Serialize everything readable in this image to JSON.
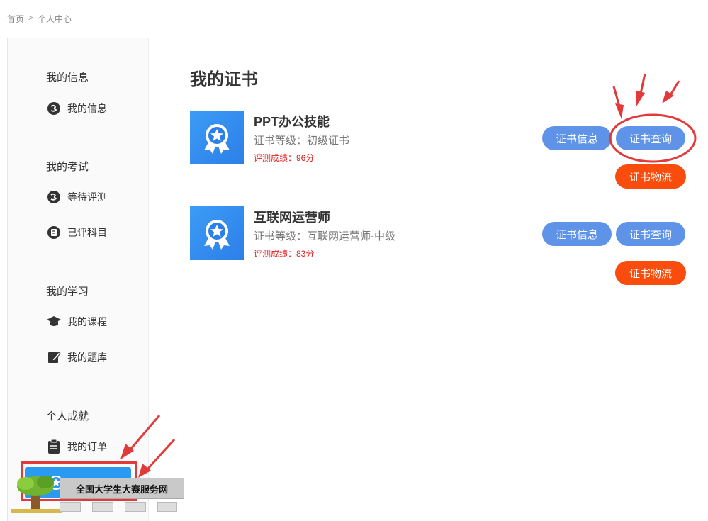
{
  "breadcrumb": {
    "home": "首页",
    "separator": ">",
    "current": "个人中心"
  },
  "sidebar": {
    "sections": [
      {
        "title": "我的信息",
        "items": [
          {
            "label": "我的信息",
            "icon": "info-icon"
          }
        ]
      },
      {
        "title": "我的考试",
        "items": [
          {
            "label": "等待评测",
            "icon": "pending-icon"
          },
          {
            "label": "已评科目",
            "icon": "done-icon"
          }
        ]
      },
      {
        "title": "我的学习",
        "items": [
          {
            "label": "我的课程",
            "icon": "graduation-cap-icon"
          },
          {
            "label": "我的题库",
            "icon": "edit-icon"
          }
        ]
      },
      {
        "title": "个人成就",
        "items": [
          {
            "label": "我的订单",
            "icon": "clipboard-icon"
          }
        ]
      }
    ]
  },
  "page": {
    "title": "我的证书"
  },
  "certificates": [
    {
      "name": "PPT办公技能",
      "level": "证书等级：初级证书",
      "score": "评测成绩：96分"
    },
    {
      "name": "互联网运营师",
      "level": "证书等级：互联网运营师-中级",
      "score": "评测成绩：83分"
    }
  ],
  "buttons": {
    "info": "证书信息",
    "query": "证书查询",
    "logistics": "证书物流"
  },
  "watermark": {
    "text": "全国大学生大赛服务网"
  },
  "colors": {
    "accent": "#2b9af3",
    "button_blue": "#5f93e8",
    "button_orange": "#fa4c0c",
    "annotation_red": "#e23a3a",
    "score_red": "#e02020"
  }
}
